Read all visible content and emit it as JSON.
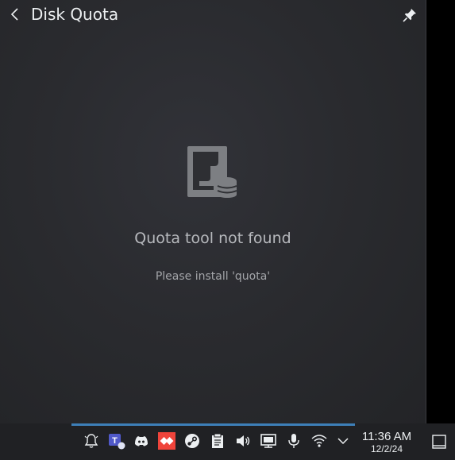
{
  "popup": {
    "title": "Disk Quota",
    "message": "Quota tool not found",
    "explanation": "Please install 'quota'"
  },
  "taskbar": {
    "tray_icons": [
      "notifications-icon",
      "teams-icon",
      "discord-icon",
      "anydesk-icon",
      "steam-icon",
      "clipboard-icon",
      "volume-icon",
      "display-icon",
      "microphone-icon",
      "wifi-icon",
      "expand-tray-icon"
    ],
    "clock": {
      "time": "11:36 AM",
      "date": "12/2/24"
    }
  },
  "colors": {
    "popup_bg": "#2a2b2f",
    "panel_bg": "#202124",
    "accent": "#3d7fb8",
    "teams": "#5059c9",
    "anydesk": "#ef443b"
  }
}
